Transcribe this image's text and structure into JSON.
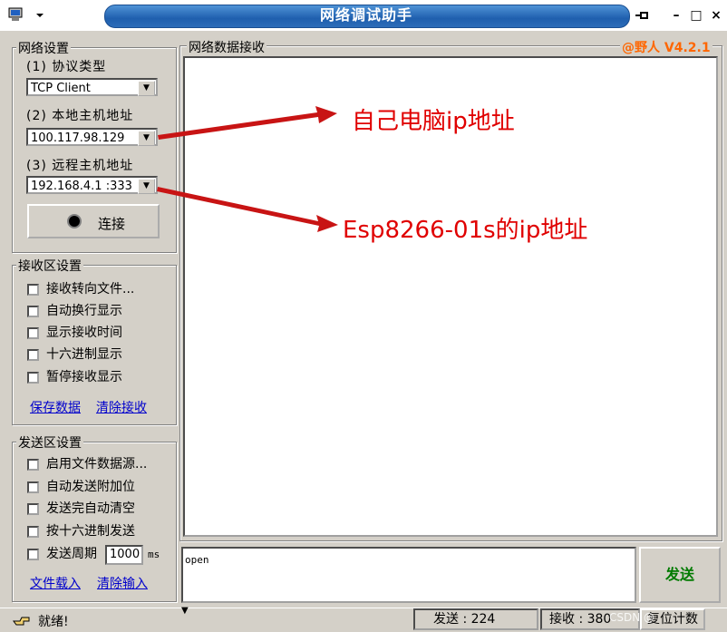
{
  "window": {
    "title": "网络调试助手",
    "brand": "@野人 V4.2.1"
  },
  "network": {
    "legend": "网络设置",
    "protocol_label": "(1) 协议类型",
    "protocol_value": "TCP Client",
    "local_label": "(2) 本地主机地址",
    "local_value": "100.117.98.129",
    "remote_label": "(3) 远程主机地址",
    "remote_value": "192.168.4.1 :333",
    "connect_label": "连接"
  },
  "receive": {
    "legend": "接收区设置",
    "options": [
      "接收转向文件...",
      "自动换行显示",
      "显示接收时间",
      "十六进制显示",
      "暂停接收显示"
    ],
    "save_link": "保存数据",
    "clear_link": "清除接收",
    "area_legend": "网络数据接收"
  },
  "send": {
    "legend": "发送区设置",
    "options": [
      "启用文件数据源...",
      "自动发送附加位",
      "发送完自动清空",
      "按十六进制发送"
    ],
    "period_label": "发送周期",
    "period_value": "1000",
    "period_unit": "ms",
    "load_link": "文件载入",
    "clear_link": "清除输入",
    "input_value": "open",
    "send_button": "发送"
  },
  "status": {
    "ready": "就绪!",
    "sent_label": "发送 : 224",
    "recv_label": "接收 : 380",
    "reset_button": "复位计数",
    "watermark": "CSDN @"
  },
  "annotations": {
    "local_note": "自己电脑ip地址",
    "remote_note": "Esp8266-01s的ip地址"
  },
  "colors": {
    "title_bar": "#1f5fae",
    "brand": "#ff6600",
    "annotation": "#e00000",
    "send_text": "#007a00"
  }
}
